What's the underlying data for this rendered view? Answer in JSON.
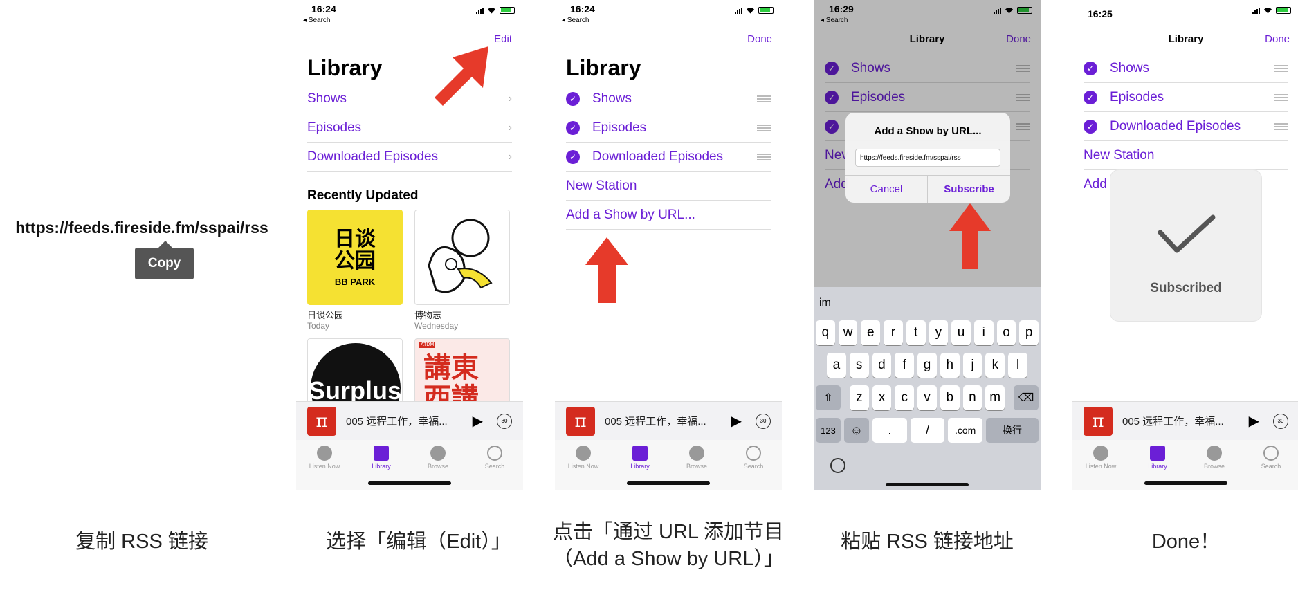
{
  "left_panel": {
    "url": "https://feeds.fireside.fm/sspai/rss",
    "copy_label": "Copy"
  },
  "captions": [
    "复制 RSS 链接",
    "选择「编辑（Edit）」",
    "点击「通过 URL 添加节目",
    "（Add a Show by URL）」",
    "粘贴 RSS 链接地址",
    "Done！"
  ],
  "phone1": {
    "time": "16:24",
    "back": "◂ Search",
    "edit": "Edit",
    "title": "Library",
    "items": [
      "Shows",
      "Episodes",
      "Downloaded Episodes"
    ],
    "section": "Recently Updated",
    "shows": [
      {
        "art_text": "日谈\n公园",
        "art_sub": "BB PARK",
        "label": "日谈公园",
        "sub": "Today"
      },
      {
        "art_text": "",
        "label": "博物志",
        "sub": "Wednesday"
      },
      {
        "art_text": "Surplus"
      },
      {
        "art_text": "講東\n西講",
        "badge": "ATDM"
      }
    ]
  },
  "phone2": {
    "time": "16:24",
    "back": "◂ Search",
    "done": "Done",
    "title": "Library",
    "items": [
      "Shows",
      "Episodes",
      "Downloaded Episodes"
    ],
    "extra": [
      "New Station",
      "Add a Show by URL..."
    ]
  },
  "phone3": {
    "time": "16:29",
    "back": "◂ Search",
    "nav_title": "Library",
    "done": "Done",
    "items": [
      "Shows",
      "Episodes"
    ],
    "partial": [
      "Nev",
      "Add"
    ],
    "dialog": {
      "title": "Add a Show by URL...",
      "url": "https://feeds.fireside.fm/sspai/rss",
      "cancel": "Cancel",
      "subscribe": "Subscribe"
    },
    "keyboard": {
      "suggestion": "im",
      "row1": [
        "q",
        "w",
        "e",
        "r",
        "t",
        "y",
        "u",
        "i",
        "o",
        "p"
      ],
      "row2": [
        "a",
        "s",
        "d",
        "f",
        "g",
        "h",
        "j",
        "k",
        "l"
      ],
      "row3": [
        "z",
        "x",
        "c",
        "v",
        "b",
        "n",
        "m"
      ],
      "row4": [
        "123",
        "☺",
        ".",
        "/",
        ".com",
        "换行"
      ]
    }
  },
  "phone4": {
    "time": "16:25",
    "nav_title": "Library",
    "done": "Done",
    "items": [
      "Shows",
      "Episodes",
      "Downloaded Episodes"
    ],
    "extra": [
      "New Station",
      "Add"
    ],
    "hud": "Subscribed"
  },
  "player": {
    "title": "005 远程工作，幸福...",
    "skip": "30",
    "pi": "π"
  },
  "tabs": [
    "Listen Now",
    "Library",
    "Browse",
    "Search"
  ],
  "colors": {
    "accent": "#6b1fd6",
    "arrow": "#e63a2a",
    "pi": "#d42b1e"
  }
}
